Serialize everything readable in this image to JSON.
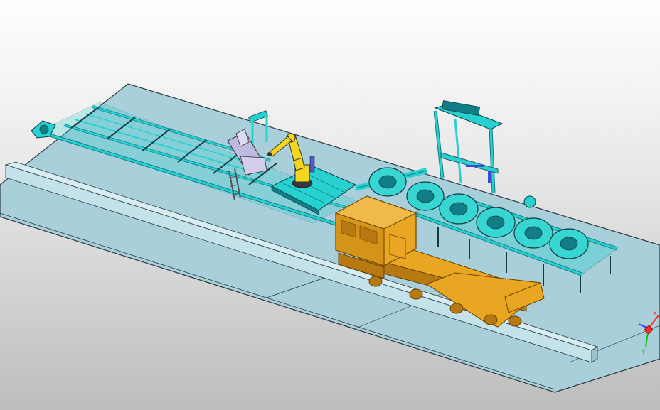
{
  "viewport": {
    "background_top": "#ffffff",
    "background_bottom": "#bdbdbd",
    "floor_color": "#a9cfda",
    "floor_edge_color": "#2b3a40",
    "curb_color": "#c4e2ea",
    "conveyor_color": "#27d1cf",
    "conveyor_shadow_color": "#117e86",
    "frame_line_color": "#0b3c44",
    "truck_color": "#e9a623",
    "truck_shadow_color": "#b77a12",
    "robot_color": "#f2d61f",
    "fixture_color": "#bdb9df",
    "wheel_color": "#38d6d2"
  },
  "objects": {
    "conveyor": "conveyor-icon",
    "robot": "robot-arm-icon",
    "fixture": "tire-fixture-icon",
    "gantry": "gantry-icon",
    "wheels": "wheel-icon",
    "truck": "truck-cab-icon",
    "triad": "axis-triad-icon"
  },
  "triad": {
    "x_label": "X",
    "y_label": "Y",
    "x_color": "#ff2a2a",
    "y_color": "#16c216",
    "z_color": "#2a3bff"
  }
}
